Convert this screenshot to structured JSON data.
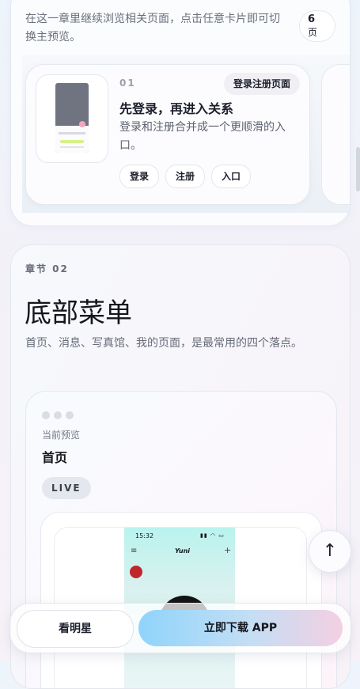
{
  "section1": {
    "intro": "在这一章里继续浏览相关页面，点击任意卡片即可切换主预览。",
    "page_count": "6",
    "page_count_unit": "页",
    "feature": {
      "index": "01",
      "badge": "登录注册页面",
      "title": "先登录，再进入关系",
      "description": "登录和注册合并成一个更顺滑的入口。",
      "chips": [
        "登录",
        "注册",
        "入口"
      ]
    }
  },
  "section2": {
    "chapter": "章节 02",
    "title": "底部菜单",
    "description": "首页、消息、写真馆、我的页面，是最常用的四个落点。",
    "preview": {
      "current_label": "当前预览",
      "current_name": "首页",
      "live_badge": "LIVE",
      "screenshot": {
        "time": "15:32",
        "app_name": "Yuni"
      }
    }
  },
  "bottom_bar": {
    "star_button": "看明星",
    "download_button": "立即下载 APP"
  },
  "icons": {
    "scroll_top": "arrow-up-icon"
  }
}
